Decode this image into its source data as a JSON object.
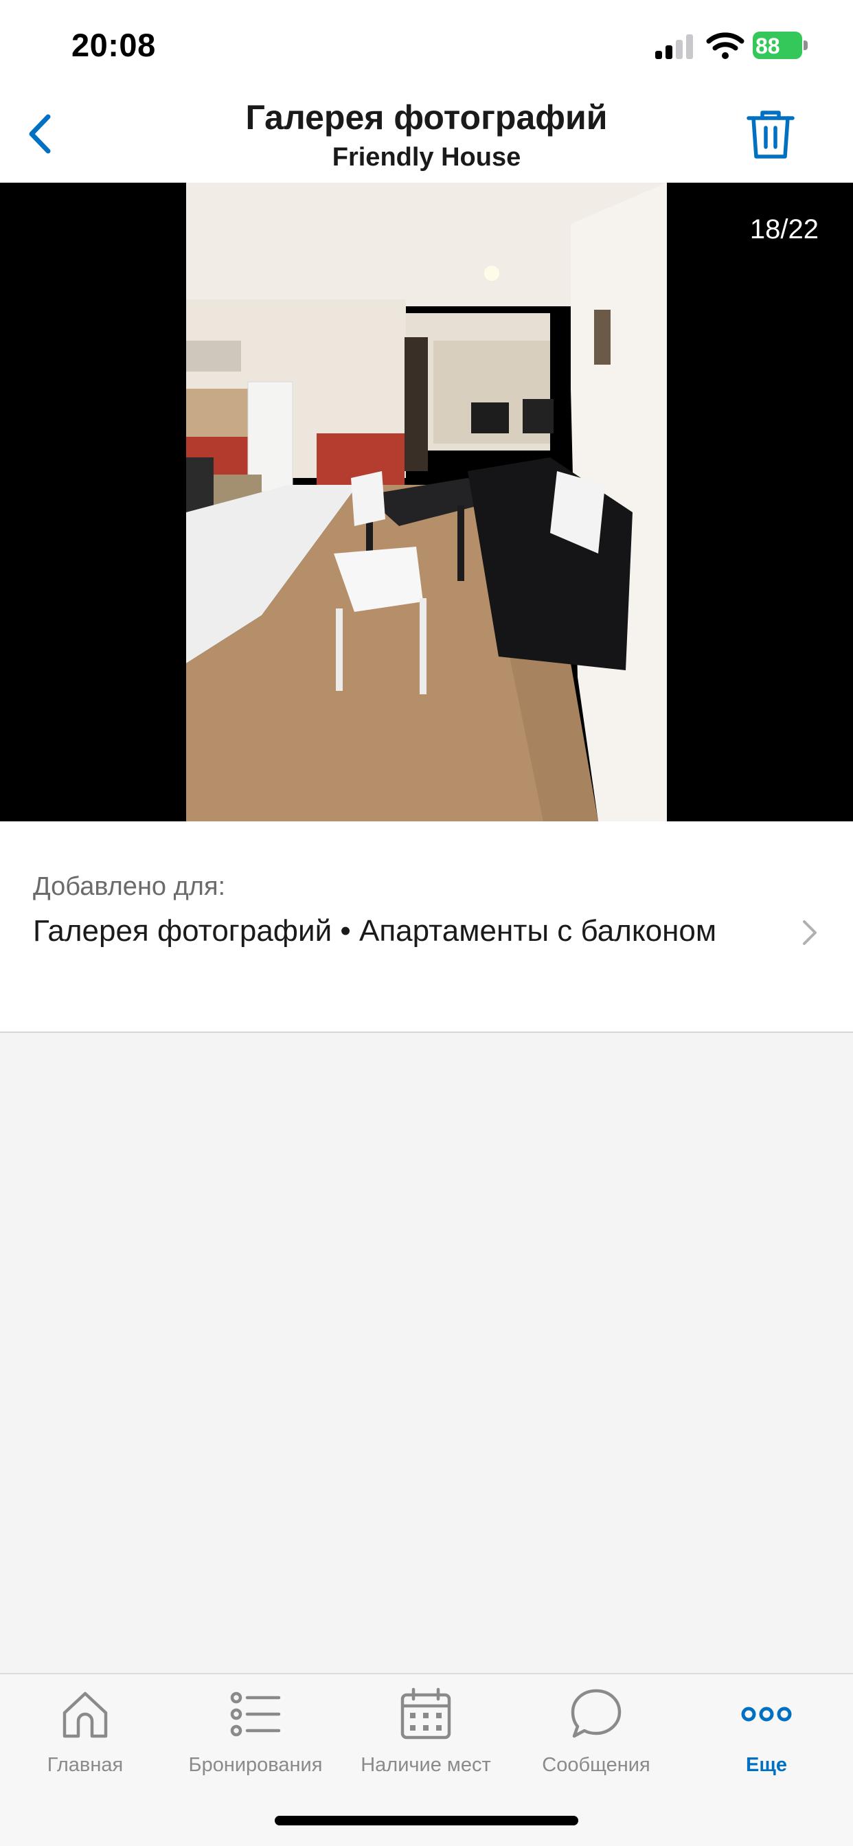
{
  "status_bar": {
    "time": "20:08",
    "battery": "88",
    "signal_icon": "cellular-signal-icon",
    "wifi_icon": "wifi-icon",
    "battery_icon": "battery-charging-icon"
  },
  "header": {
    "title": "Галерея фотографий",
    "subtitle": "Friendly House",
    "back_icon": "chevron-left-icon",
    "delete_icon": "trash-icon"
  },
  "photo": {
    "counter": "18/22",
    "subject": "apartment-interior"
  },
  "added_for": {
    "label": "Добавлено для:",
    "value": "Галерея фотографий • Апартаменты с балконом",
    "chevron_icon": "chevron-right-icon"
  },
  "tabs": [
    {
      "label": "Главная",
      "icon": "home-icon",
      "active": false
    },
    {
      "label": "Бронирования",
      "icon": "list-icon",
      "active": false
    },
    {
      "label": "Наличие мест",
      "icon": "calendar-icon",
      "active": false
    },
    {
      "label": "Сообщения",
      "icon": "chat-bubble-icon",
      "active": false
    },
    {
      "label": "Еще",
      "icon": "more-dots-icon",
      "active": true
    }
  ],
  "colors": {
    "accent": "#0071c2",
    "battery": "#34c759",
    "inactive_tab": "#8a8a8a",
    "background": "#f4f4f4"
  }
}
